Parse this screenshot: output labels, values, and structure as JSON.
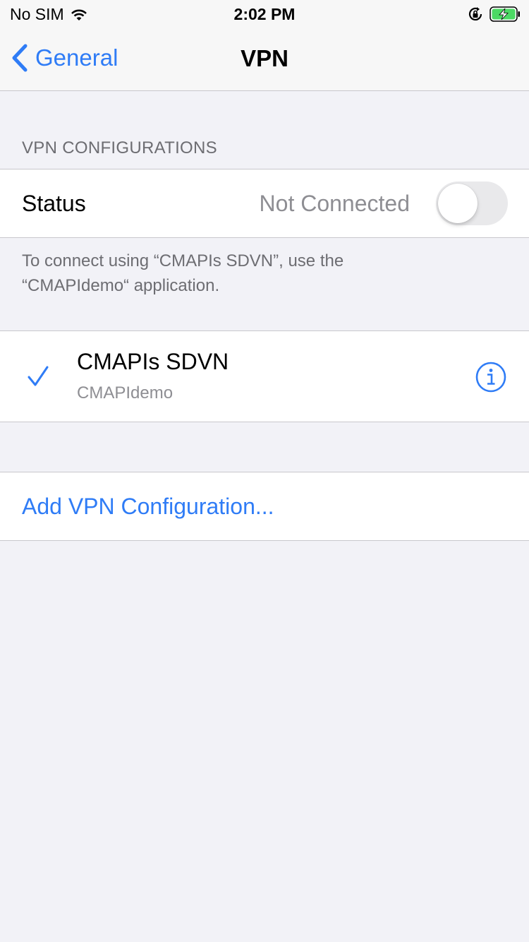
{
  "status_bar": {
    "carrier": "No SIM",
    "time": "2:02 PM",
    "wifi_icon": "wifi-icon",
    "orientation_lock_icon": "orientation-lock-icon",
    "battery_icon": "battery-charging-icon",
    "battery_color": "#4cd964"
  },
  "nav": {
    "back_label": "General",
    "title": "VPN",
    "accent_color": "#2f7cf6"
  },
  "section": {
    "header": "VPN CONFIGURATIONS"
  },
  "status_row": {
    "label": "Status",
    "value": "Not Connected",
    "toggle_on": false
  },
  "footer_text": "To connect using “CMAPIs SDVN”, use the “CMAPIdemo“ application.",
  "vpn_item": {
    "name": "CMAPIs SDVN",
    "app": "CMAPIdemo",
    "selected": true,
    "check_icon": "checkmark-icon",
    "info_icon": "info-icon"
  },
  "add_button": {
    "label": "Add VPN Configuration..."
  }
}
